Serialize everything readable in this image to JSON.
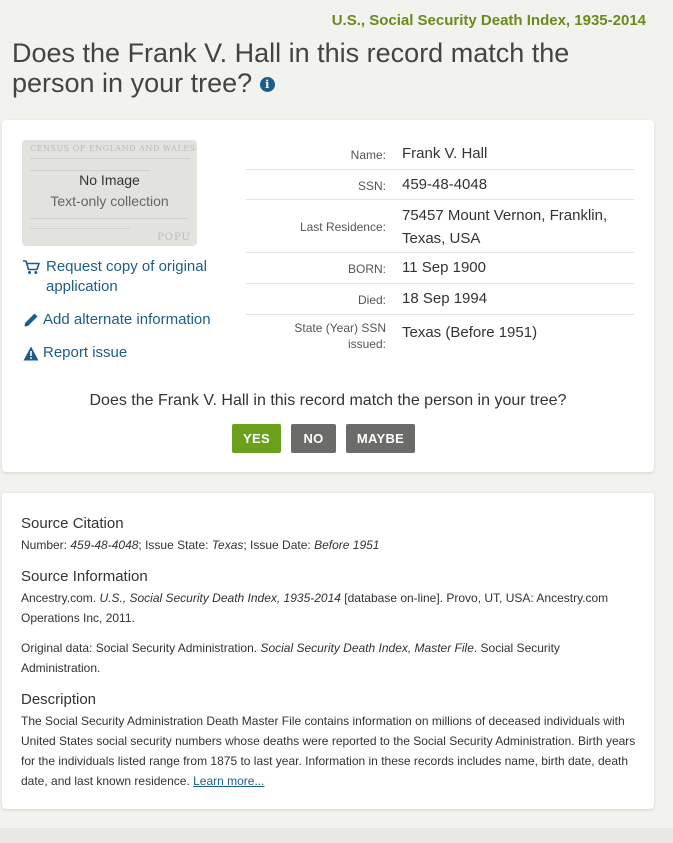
{
  "header": {
    "collection_title": "U.S., Social Security Death Index, 1935-2014",
    "question_title": "Does the Frank V. Hall in this record match the person in your tree?",
    "info_icon_glyph": "i"
  },
  "thumbnail": {
    "no_image_label": "No Image",
    "subtext": "Text-only collection",
    "watermark_top": "CENSUS OF ENGLAND AND WALES",
    "watermark_bottom": "POPU"
  },
  "actions": {
    "request_copy": "Request copy of original application",
    "add_info": "Add alternate information",
    "report_issue": "Report issue"
  },
  "details": [
    {
      "label": "Name:",
      "value": "Frank V. Hall"
    },
    {
      "label": "SSN:",
      "value": "459-48-4048"
    },
    {
      "label": "Last Residence:",
      "value": "75457 Mount Vernon, Franklin, Texas, USA"
    },
    {
      "label": "BORN:",
      "value": "11 Sep 1900"
    },
    {
      "label": "Died:",
      "value": "18 Sep 1994"
    },
    {
      "label": "State (Year) SSN issued:",
      "value": "Texas (Before 1951)"
    }
  ],
  "match": {
    "question": "Does the Frank V. Hall in this record match the person in your tree?",
    "yes_label": "YES",
    "no_label": "NO",
    "maybe_label": "MAYBE"
  },
  "source_citation": {
    "heading": "Source Citation",
    "number_label": "Number: ",
    "number_value": "459-48-4048",
    "issue_state_label": "; Issue State: ",
    "issue_state_value": "Texas",
    "issue_date_label": "; Issue Date: ",
    "issue_date_value": "Before 1951"
  },
  "source_information": {
    "heading": "Source Information",
    "line1_prefix": "Ancestry.com. ",
    "line1_title": "U.S., Social Security Death Index, 1935-2014",
    "line1_suffix": " [database on-line]. Provo, UT, USA: Ancestry.com Operations Inc, 2011.",
    "line2_prefix": "Original data: Social Security Administration. ",
    "line2_title": "Social Security Death Index, Master File",
    "line2_suffix": ". Social Security Administration."
  },
  "description": {
    "heading": "Description",
    "text": "The Social Security Administration Death Master File contains information on millions of deceased individuals with United States social security numbers whose deaths were reported to the Social Security Administration. Birth years for the individuals listed range from 1875 to last year. Information in these records includes name, birth date, death date, and last known residence. ",
    "learn_more": "Learn more..."
  },
  "colors": {
    "collection_title": "#6b8a1e",
    "link": "#1b5e88",
    "yes_button": "#6ba01c",
    "neutral_button": "#6b6b69",
    "page_background": "#f2f2ee"
  }
}
